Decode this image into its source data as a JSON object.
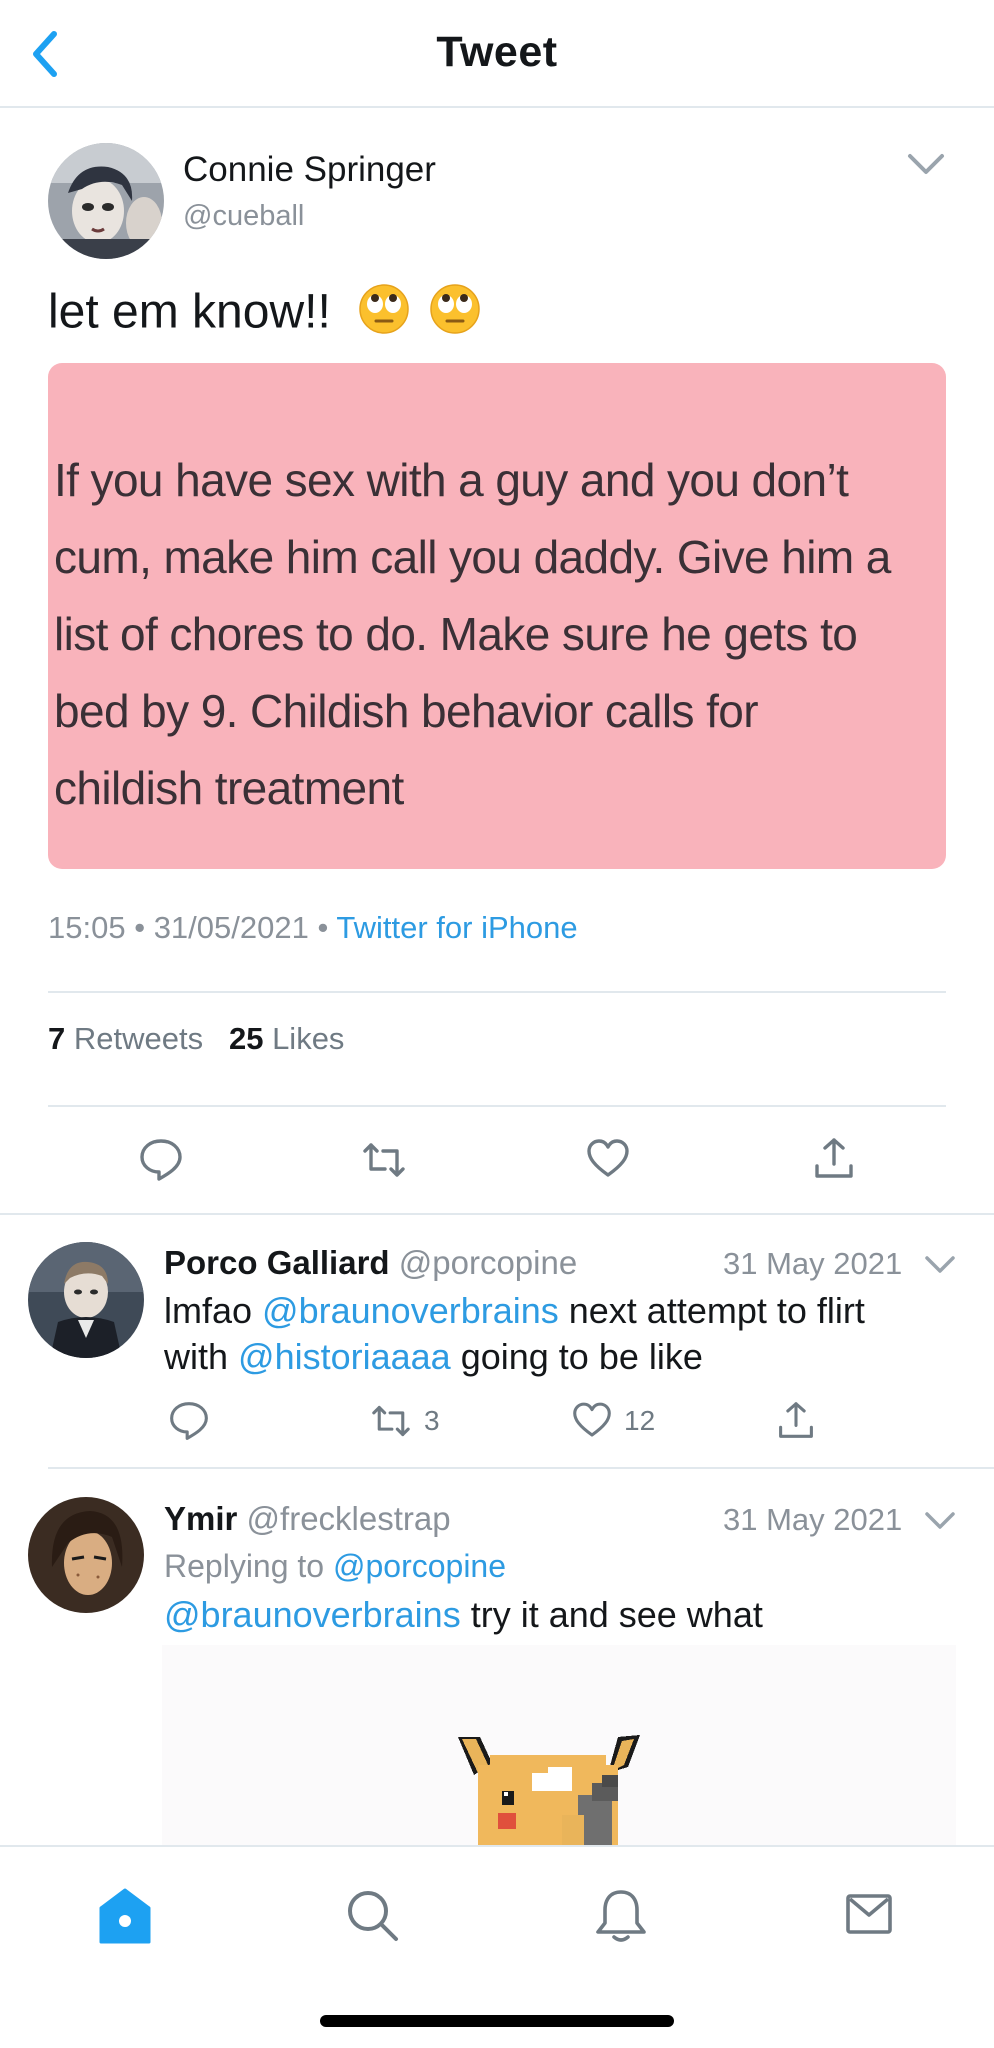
{
  "header": {
    "title": "Tweet"
  },
  "main_tweet": {
    "author_name": "Connie Springer",
    "author_handle": "@cueball",
    "text": "let em know!!",
    "emojis": [
      "face-with-rolling-eyes",
      "face-with-rolling-eyes"
    ],
    "media_text": [
      "If you have sex with a guy and you don’t",
      "cum, make him call you daddy. Give him a",
      "list of chores to do. Make sure he gets to",
      "bed by 9. Childish behavior calls for",
      "childish treatment"
    ],
    "time": "15:05",
    "date": "31/05/2021",
    "source": "Twitter for iPhone",
    "separator": "•",
    "retweets_count": "7",
    "retweets_label": "Retweets",
    "likes_count": "25",
    "likes_label": "Likes"
  },
  "replies": [
    {
      "name": "Porco Galliard",
      "handle": "@porcopine",
      "date": "31 May 2021",
      "text_parts": [
        "lmfao ",
        "@braunoverbrains",
        " next attempt to flirt",
        "with ",
        "@historiaaaa",
        " going to be like"
      ],
      "retweets": "3",
      "likes": "12"
    },
    {
      "name": "Ymir",
      "handle": "@frecklestrap",
      "date": "31 May 2021",
      "replying_to_label": "Replying to ",
      "replying_to_handle": "@porcopine",
      "text_parts": [
        "@braunoverbrains",
        " try it and see what"
      ]
    }
  ],
  "colors": {
    "link": "#2d9be2",
    "home_active": "#1da1f2",
    "media_bg": "#f9b3bb"
  },
  "tabbar": [
    "home-icon",
    "search-icon",
    "notifications-icon",
    "messages-icon"
  ]
}
